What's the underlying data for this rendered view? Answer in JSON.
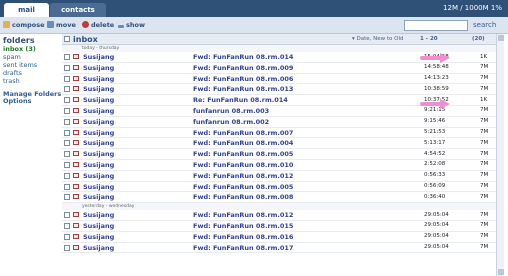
{
  "tabs": [
    {
      "label": "mail"
    },
    {
      "label": "contacts"
    }
  ],
  "quota": "12M / 1000M 1%",
  "toolbar": {
    "compose": "compose",
    "move": "move",
    "delete": "delete",
    "show": "show",
    "search_label": "search",
    "search_value": ""
  },
  "sidebar": {
    "heading": "folders",
    "items": [
      {
        "label": "inbox (3)"
      },
      {
        "label": "spam"
      },
      {
        "label": "sent items"
      },
      {
        "label": "drafts"
      },
      {
        "label": "trash"
      }
    ],
    "manage": "Manage Folders",
    "options": "Options"
  },
  "list": {
    "title": "inbox",
    "sort": "▾ Date, New to Old",
    "range": "1 - 20",
    "count": "(20)"
  },
  "groups": {
    "today": "today - thursday",
    "yesterday": "yesterday - wednesday"
  },
  "rows_today": [
    {
      "from": "Susijang",
      "subject": "Fwd: FunFanRun 08.rm.014",
      "time": "15:04:58",
      "size": "1K"
    },
    {
      "from": "Susijang",
      "subject": "Fwd: FunFanRun 08.rm.009",
      "time": "14:58:48",
      "size": "7M"
    },
    {
      "from": "Susijang",
      "subject": "Fwd: FunFanRun 08.rm.006",
      "time": "14:13:23",
      "size": "7M"
    },
    {
      "from": "Susijang",
      "subject": "Fwd: FunFanRun 08.rm.013",
      "time": "10:38:59",
      "size": "7M"
    },
    {
      "from": "Susijang",
      "subject": "Re: FunFanRun 08.rm.014",
      "time": "10:37:52",
      "size": "1K"
    },
    {
      "from": "Susijang",
      "subject": "funfanrun 08.rm.003",
      "time": "9:21:15",
      "size": "7M"
    },
    {
      "from": "Susijang",
      "subject": "funfanrun 08.rm.002",
      "time": "9:15:46",
      "size": "7M"
    },
    {
      "from": "Susijang",
      "subject": "Fwd: FunFanRun 08.rm.007",
      "time": "5:21:53",
      "size": "7M"
    },
    {
      "from": "Susijang",
      "subject": "Fwd: FunFanRun 08.rm.004",
      "time": "5:13:17",
      "size": "7M"
    },
    {
      "from": "Susijang",
      "subject": "Fwd: FunFanRun 08.rm.005",
      "time": "4:54:52",
      "size": "7M"
    },
    {
      "from": "Susijang",
      "subject": "Fwd: FunFanRun 08.rm.010",
      "time": "2:52:08",
      "size": "7M"
    },
    {
      "from": "Susijang",
      "subject": "Fwd: FunFanRun 08.rm.012",
      "time": "0:56:33",
      "size": "7M"
    },
    {
      "from": "Susijang",
      "subject": "Fwd: FunFanRun 08.rm.005",
      "time": "0:56:09",
      "size": "7M"
    },
    {
      "from": "Susijang",
      "subject": "Fwd: FunFanRun 08.rm.008",
      "time": "0:36:40",
      "size": "7M"
    }
  ],
  "rows_yesterday": [
    {
      "from": "Susijang",
      "subject": "Fwd: FunFanRun 08.rm.012",
      "time": "29:05:04",
      "size": "7M"
    },
    {
      "from": "Susijang",
      "subject": "Fwd: FunFanRun 08.rm.015",
      "time": "29:05:04",
      "size": "7M"
    },
    {
      "from": "Susijang",
      "subject": "Fwd: FunFanRun 08.rm.016",
      "time": "29:05:04",
      "size": "7M"
    },
    {
      "from": "Susijang",
      "subject": "Fwd: FunFanRun 08.rm.017",
      "time": "29:05:04",
      "size": "7M"
    }
  ],
  "colors": {
    "topbar": "#2f5177",
    "link": "#2f3f9b",
    "highlight_arrow": "#f08fd0"
  }
}
